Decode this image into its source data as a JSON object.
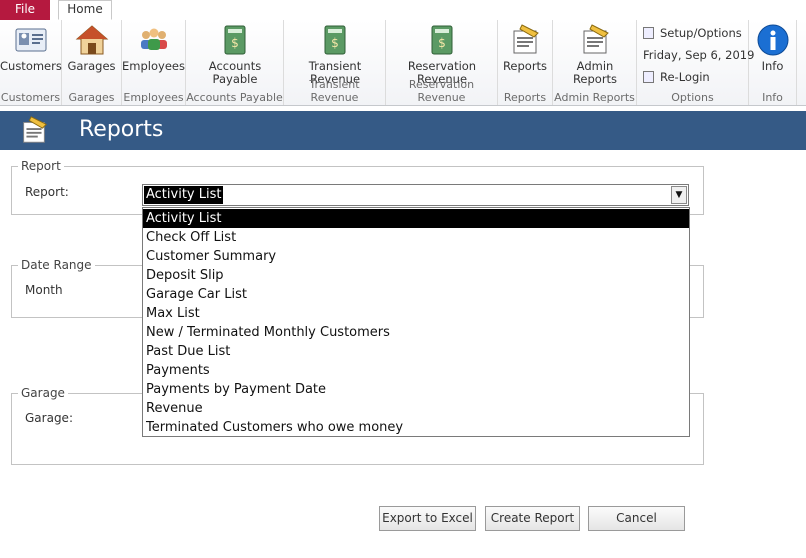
{
  "tabs": {
    "file": "File",
    "home": "Home"
  },
  "ribbon": {
    "buttons": [
      {
        "label": "Customers",
        "group": "Customers",
        "icon": "customers-card-icon"
      },
      {
        "label": "Garages",
        "group": "Garages",
        "icon": "house-icon"
      },
      {
        "label": "Employees",
        "group": "Employees",
        "icon": "people-icon"
      },
      {
        "label": "Accounts Payable",
        "group": "Accounts Payable",
        "icon": "ledger-book-icon"
      },
      {
        "label": "Transient Revenue",
        "group": "Transient Revenue",
        "icon": "ledger-book-icon"
      },
      {
        "label": "Reservation Revenue",
        "group": "Reservation Revenue",
        "icon": "ledger-book-icon"
      },
      {
        "label": "Reports",
        "group": "Reports",
        "icon": "report-icon"
      },
      {
        "label": "Admin Reports",
        "group": "Admin Reports",
        "icon": "admin-report-icon"
      }
    ],
    "options": {
      "setup": "Setup/Options",
      "date": "Friday, Sep 6, 2019",
      "relogin": "Re-Login",
      "group": "Options"
    },
    "info": {
      "label": "Info",
      "group": "Info"
    }
  },
  "header": {
    "title": "Reports"
  },
  "form": {
    "report_section": "Report",
    "report_label": "Report:",
    "report_selected": "Activity List",
    "report_options": [
      "Activity List",
      "Check Off List",
      "Customer Summary",
      "Deposit Slip",
      "Garage Car List",
      "Max List",
      "New / Terminated Monthly Customers",
      "Past Due List",
      "Payments",
      "Payments by Payment Date",
      "Revenue",
      "Terminated Customers who owe money"
    ],
    "date_range_section": "Date Range",
    "month_label": "Month",
    "garage_section": "Garage",
    "garage_label": "Garage:"
  },
  "actions": {
    "export": "Export to Excel",
    "create": "Create Report",
    "cancel": "Cancel"
  },
  "colors": {
    "file_tab": "#b5193f",
    "header_bar": "#355a86",
    "info_icon": "#1b6fd3",
    "ledger_green": "#5b9a64"
  }
}
